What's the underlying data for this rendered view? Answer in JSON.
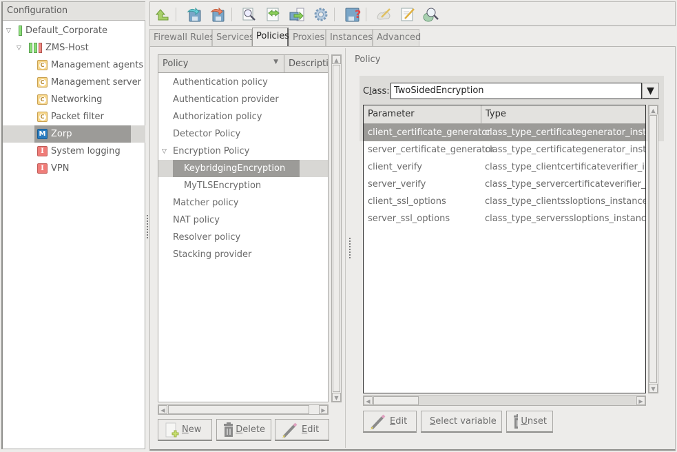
{
  "sidebar": {
    "header": "Configuration",
    "items": [
      {
        "label": "Default_Corporate",
        "level": 0,
        "expanded": true,
        "icon": "status-bar-green"
      },
      {
        "label": "ZMS-Host",
        "level": 1,
        "expanded": true,
        "icon": "status-bars-green-green-red"
      },
      {
        "label": "Management agents",
        "level": 2,
        "icon": "component-c-icon"
      },
      {
        "label": "Management server",
        "level": 2,
        "icon": "component-c-icon"
      },
      {
        "label": "Networking",
        "level": 2,
        "icon": "component-c-icon"
      },
      {
        "label": "Packet filter",
        "level": 2,
        "icon": "component-c-icon"
      },
      {
        "label": "Zorp",
        "level": 2,
        "icon": "component-m-icon",
        "selected": true
      },
      {
        "label": "System logging",
        "level": 2,
        "icon": "component-i-icon"
      },
      {
        "label": "VPN",
        "level": 2,
        "icon": "component-i-icon"
      }
    ],
    "icon_glyphs": {
      "c": "C",
      "m": "M",
      "i": "I"
    }
  },
  "toolbar": {
    "buttons": [
      {
        "name": "upload-icon"
      },
      {
        "name": "commit-icon"
      },
      {
        "name": "revert-icon"
      },
      {
        "name": "view-icon"
      },
      {
        "name": "compare-icon"
      },
      {
        "name": "transfer-icon"
      },
      {
        "name": "settings-icon"
      },
      {
        "name": "save-help-icon"
      },
      {
        "name": "wizard-icon"
      },
      {
        "name": "edit-document-icon"
      },
      {
        "name": "search-icon"
      }
    ]
  },
  "tabs": [
    {
      "label": "Firewall Rules",
      "active": false
    },
    {
      "label": "Services",
      "active": false
    },
    {
      "label": "Policies",
      "active": true
    },
    {
      "label": "Proxies",
      "active": false
    },
    {
      "label": "Instances",
      "active": false
    },
    {
      "label": "Advanced",
      "active": false
    }
  ],
  "policy_list": {
    "columns": [
      "Policy",
      "Descriptio"
    ],
    "sort_indicator": "▼",
    "rows": [
      {
        "label": "Authentication policy",
        "level": 0
      },
      {
        "label": "Authentication provider",
        "level": 0
      },
      {
        "label": "Authorization policy",
        "level": 0
      },
      {
        "label": "Detector Policy",
        "level": 0
      },
      {
        "label": "Encryption Policy",
        "level": 0,
        "expanded": true
      },
      {
        "label": "KeybridgingEncryption",
        "level": 1,
        "selected": true
      },
      {
        "label": "MyTLSEncryption",
        "level": 1
      },
      {
        "label": "Matcher policy",
        "level": 0
      },
      {
        "label": "NAT policy",
        "level": 0
      },
      {
        "label": "Resolver policy",
        "level": 0
      },
      {
        "label": "Stacking provider",
        "level": 0
      }
    ],
    "buttons": {
      "new": "New",
      "delete": "Delete",
      "edit": "Edit"
    },
    "mnemonics": {
      "new": "N",
      "delete": "D",
      "edit": "E"
    }
  },
  "detail": {
    "section_title": "Policy",
    "class_label_pre": "C",
    "class_label_mn": "l",
    "class_label_post": "ass:",
    "class_value": "TwoSidedEncryption",
    "table": {
      "columns": [
        "Parameter",
        "Type"
      ],
      "rows": [
        {
          "parameter": "client_certificate_generator",
          "type": "class_type_certificategenerator_instance",
          "selected": true
        },
        {
          "parameter": "server_certificate_generator",
          "type": "class_type_certificategenerator_instance"
        },
        {
          "parameter": "client_verify",
          "type": "class_type_clientcertificateverifier_instance"
        },
        {
          "parameter": "server_verify",
          "type": "class_type_servercertificateverifier_instance"
        },
        {
          "parameter": "client_ssl_options",
          "type": "class_type_clientssloptions_instance"
        },
        {
          "parameter": "server_ssl_options",
          "type": "class_type_serverssloptions_instance"
        }
      ]
    },
    "buttons": {
      "edit": "Edit",
      "select_variable": "Select variable",
      "unset": "Unset"
    }
  },
  "colors": {
    "selection": "#9c9b98",
    "selection_row": "#d8d7d4",
    "background": "#edecea"
  }
}
